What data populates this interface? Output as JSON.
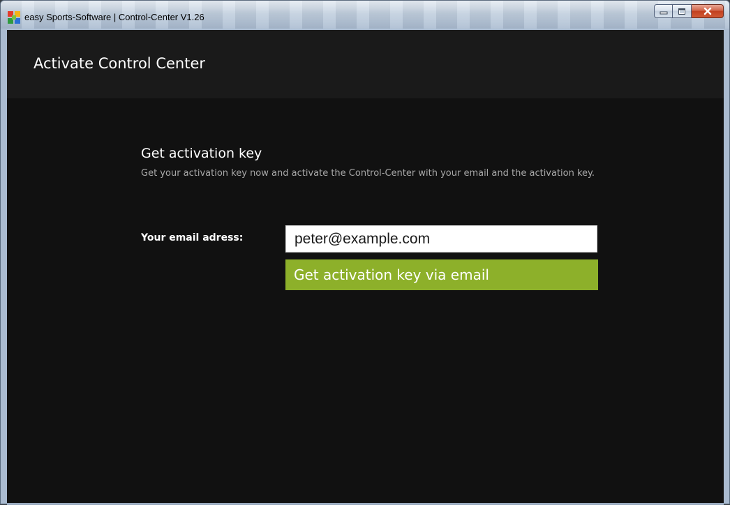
{
  "window": {
    "title": "easy Sports-Software | Control-Center V1.26",
    "buttons": {
      "minimize_icon": "minimize-icon",
      "maximize_icon": "maximize-icon",
      "close_icon": "close-icon"
    },
    "app_icon": "easy-sports-logo-icon"
  },
  "header": {
    "title": "Activate Control Center"
  },
  "activation": {
    "heading": "Get activation key",
    "description": "Get your activation key now and activate the Control-Center with your email and the activation key.",
    "email_label": "Your email adress:",
    "email_value": "peter@example.com",
    "button_label": "Get activation key via email"
  },
  "colors": {
    "background": "#111111",
    "header_band": "#1a1a1a",
    "accent_button": "#8db02a",
    "description_text": "#a8a8a8"
  }
}
